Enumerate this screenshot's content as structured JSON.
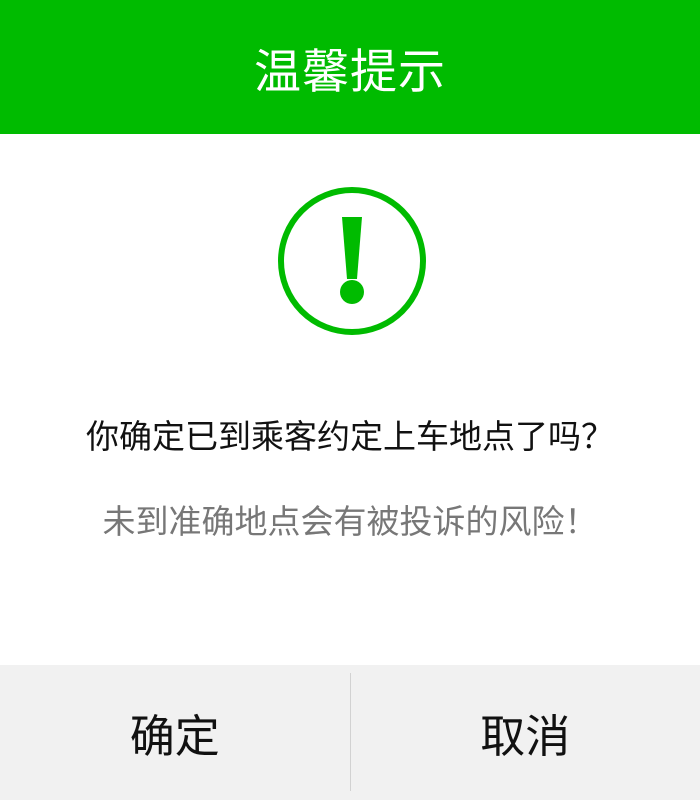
{
  "dialog": {
    "title": "温馨提示",
    "icon": "exclamation-circle-icon",
    "message": "你确定已到乘客约定上车地点了吗？",
    "warning": "未到准确地点会有被投诉的风险！",
    "confirm_label": "确定",
    "cancel_label": "取消"
  },
  "colors": {
    "accent": "#00bb00",
    "footer_bg": "#f1f1f1",
    "warning_text": "#777777"
  }
}
